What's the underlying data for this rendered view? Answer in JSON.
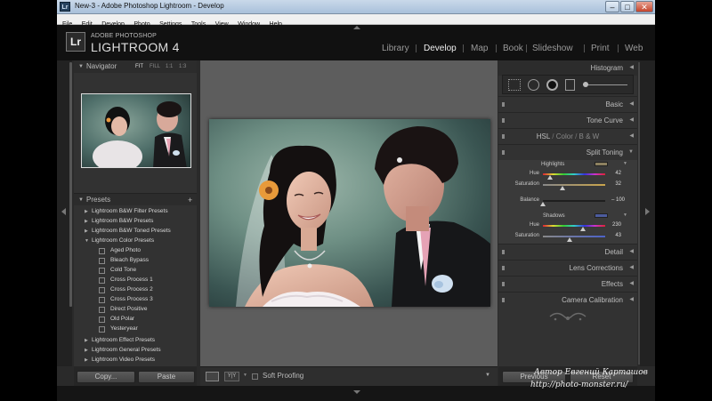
{
  "window": {
    "title": "New-3 - Adobe Photoshop Lightroom - Develop",
    "app_icon": "Lr",
    "min": "–",
    "max": "□",
    "close": "✕"
  },
  "menubar": [
    "File",
    "Edit",
    "Develop",
    "Photo",
    "Settings",
    "Tools",
    "View",
    "Window",
    "Help"
  ],
  "identity": {
    "small": "ADOBE PHOTOSHOP",
    "big": "LIGHTROOM 4",
    "logo": "Lr"
  },
  "modules": [
    "Library",
    "Develop",
    "Map",
    "Book",
    "Slideshow",
    "Print",
    "Web"
  ],
  "navigator": {
    "title": "Navigator",
    "zoom": [
      "FIT",
      "FILL",
      "1:1",
      "1:3"
    ]
  },
  "presets": {
    "title": "Presets",
    "add": "+",
    "items": [
      {
        "label": "Lightroom B&W Filter Presets",
        "type": "folder",
        "open": false
      },
      {
        "label": "Lightroom B&W Presets",
        "type": "folder",
        "open": false
      },
      {
        "label": "Lightroom B&W Toned Presets",
        "type": "folder",
        "open": false
      },
      {
        "label": "Lightroom Color Presets",
        "type": "folder",
        "open": true
      },
      {
        "label": "Aged Photo",
        "type": "item"
      },
      {
        "label": "Bleach Bypass",
        "type": "item"
      },
      {
        "label": "Cold Tone",
        "type": "item"
      },
      {
        "label": "Cross Process 1",
        "type": "item"
      },
      {
        "label": "Cross Process 2",
        "type": "item"
      },
      {
        "label": "Cross Process 3",
        "type": "item"
      },
      {
        "label": "Direct Positive",
        "type": "item"
      },
      {
        "label": "Old Polar",
        "type": "item"
      },
      {
        "label": "Yesteryear",
        "type": "item"
      },
      {
        "label": "Lightroom Effect Presets",
        "type": "folder",
        "open": false
      },
      {
        "label": "Lightroom General Presets",
        "type": "folder",
        "open": false
      },
      {
        "label": "Lightroom Video Presets",
        "type": "folder",
        "open": false
      }
    ]
  },
  "left_buttons": {
    "copy": "Copy...",
    "paste": "Paste"
  },
  "toolbar": {
    "soft_proofing": "Soft Proofing",
    "view_yy": "Y|Y"
  },
  "right_panel": {
    "histogram": "Histogram",
    "basic": "Basic",
    "tone_curve": "Tone Curve",
    "hsl": "HSL",
    "color": "Color",
    "bw": "B & W",
    "split_toning": "Split Toning",
    "highlights": {
      "label": "Highlights",
      "hue_label": "Hue",
      "hue": "42",
      "sat_label": "Saturation",
      "sat": "32",
      "swatch": "#8d8160",
      "hue_frac": 0.12,
      "sat_frac": 0.32
    },
    "balance": {
      "label": "Balance",
      "value": "– 100",
      "frac": 0.0
    },
    "shadows": {
      "label": "Shadows",
      "hue_label": "Hue",
      "hue": "230",
      "sat_label": "Saturation",
      "sat": "43",
      "swatch": "#4c5c9e",
      "hue_frac": 0.64,
      "sat_frac": 0.43
    },
    "detail": "Detail",
    "lens_corrections": "Lens Corrections",
    "effects": "Effects",
    "camera_calibration": "Camera Calibration"
  },
  "right_buttons": {
    "previous": "Previous",
    "reset": "Reset"
  },
  "watermark": {
    "line1": "Автор Евгений Карташов",
    "line2": "http://photo-monster.ru/"
  }
}
